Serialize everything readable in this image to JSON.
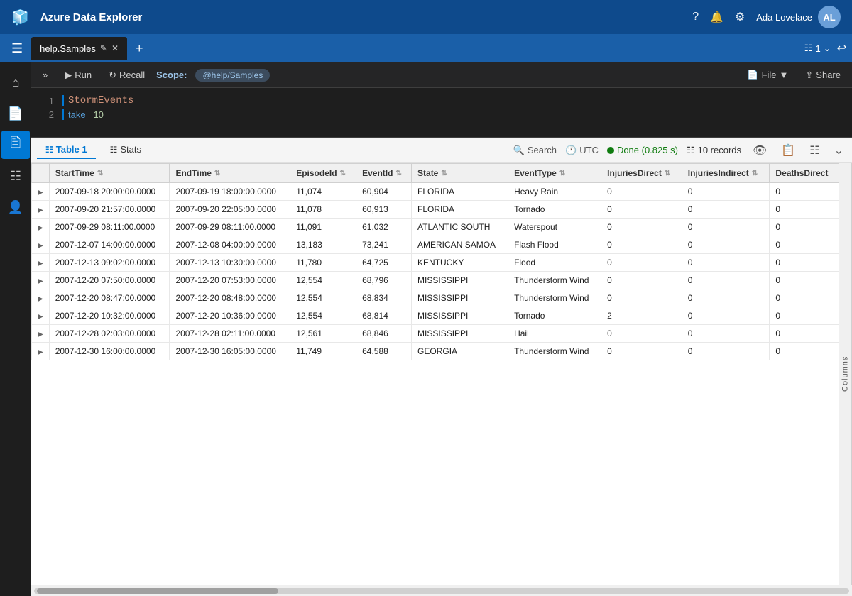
{
  "app": {
    "title": "Azure Data Explorer"
  },
  "topbar": {
    "help_icon": "?",
    "notification_icon": "🔔",
    "settings_icon": "⚙",
    "user_name": "Ada Lovelace"
  },
  "tabbar": {
    "tab_name": "help.Samples",
    "tab_counter": "1",
    "undo_icon": "↩"
  },
  "toolbar": {
    "run_label": "Run",
    "recall_label": "Recall",
    "scope_label": "Scope:",
    "scope_value": "@help/Samples",
    "file_label": "File",
    "share_label": "Share"
  },
  "query": {
    "line1": "StormEvents",
    "line2_kw": "take",
    "line2_num": "10"
  },
  "results": {
    "table_tab": "Table 1",
    "stats_tab": "Stats",
    "search_placeholder": "Search",
    "utc_label": "UTC",
    "status_label": "Done (0.825 s)",
    "records_label": "10 records",
    "columns_label": "Columns"
  },
  "columns": {
    "headers": [
      "",
      "StartTime",
      "EndTime",
      "EpisodeId",
      "EventId",
      "State",
      "EventType",
      "InjuriesDirect",
      "InjuriesIndirect",
      "DeathsDirect"
    ]
  },
  "rows": [
    {
      "expand": ">",
      "StartTime": "2007-09-18 20:00:00.0000",
      "EndTime": "2007-09-19 18:00:00.0000",
      "EpisodeId": "11,074",
      "EventId": "60,904",
      "State": "FLORIDA",
      "EventType": "Heavy Rain",
      "InjuriesDirect": "0",
      "InjuriesIndirect": "0",
      "DeathsDirect": "0"
    },
    {
      "expand": ">",
      "StartTime": "2007-09-20 21:57:00.0000",
      "EndTime": "2007-09-20 22:05:00.0000",
      "EpisodeId": "11,078",
      "EventId": "60,913",
      "State": "FLORIDA",
      "EventType": "Tornado",
      "InjuriesDirect": "0",
      "InjuriesIndirect": "0",
      "DeathsDirect": "0"
    },
    {
      "expand": ">",
      "StartTime": "2007-09-29 08:11:00.0000",
      "EndTime": "2007-09-29 08:11:00.0000",
      "EpisodeId": "11,091",
      "EventId": "61,032",
      "State": "ATLANTIC SOUTH",
      "EventType": "Waterspout",
      "InjuriesDirect": "0",
      "InjuriesIndirect": "0",
      "DeathsDirect": "0"
    },
    {
      "expand": ">",
      "StartTime": "2007-12-07 14:00:00.0000",
      "EndTime": "2007-12-08 04:00:00.0000",
      "EpisodeId": "13,183",
      "EventId": "73,241",
      "State": "AMERICAN SAMOA",
      "EventType": "Flash Flood",
      "InjuriesDirect": "0",
      "InjuriesIndirect": "0",
      "DeathsDirect": "0"
    },
    {
      "expand": ">",
      "StartTime": "2007-12-13 09:02:00.0000",
      "EndTime": "2007-12-13 10:30:00.0000",
      "EpisodeId": "11,780",
      "EventId": "64,725",
      "State": "KENTUCKY",
      "EventType": "Flood",
      "InjuriesDirect": "0",
      "InjuriesIndirect": "0",
      "DeathsDirect": "0"
    },
    {
      "expand": ">",
      "StartTime": "2007-12-20 07:50:00.0000",
      "EndTime": "2007-12-20 07:53:00.0000",
      "EpisodeId": "12,554",
      "EventId": "68,796",
      "State": "MISSISSIPPI",
      "EventType": "Thunderstorm Wind",
      "InjuriesDirect": "0",
      "InjuriesIndirect": "0",
      "DeathsDirect": "0"
    },
    {
      "expand": ">",
      "StartTime": "2007-12-20 08:47:00.0000",
      "EndTime": "2007-12-20 08:48:00.0000",
      "EpisodeId": "12,554",
      "EventId": "68,834",
      "State": "MISSISSIPPI",
      "EventType": "Thunderstorm Wind",
      "InjuriesDirect": "0",
      "InjuriesIndirect": "0",
      "DeathsDirect": "0"
    },
    {
      "expand": ">",
      "StartTime": "2007-12-20 10:32:00.0000",
      "EndTime": "2007-12-20 10:36:00.0000",
      "EpisodeId": "12,554",
      "EventId": "68,814",
      "State": "MISSISSIPPI",
      "EventType": "Tornado",
      "InjuriesDirect": "2",
      "InjuriesIndirect": "0",
      "DeathsDirect": "0"
    },
    {
      "expand": ">",
      "StartTime": "2007-12-28 02:03:00.0000",
      "EndTime": "2007-12-28 02:11:00.0000",
      "EpisodeId": "12,561",
      "EventId": "68,846",
      "State": "MISSISSIPPI",
      "EventType": "Hail",
      "InjuriesDirect": "0",
      "InjuriesIndirect": "0",
      "DeathsDirect": "0"
    },
    {
      "expand": ">",
      "StartTime": "2007-12-30 16:00:00.0000",
      "EndTime": "2007-12-30 16:05:00.0000",
      "EpisodeId": "11,749",
      "EventId": "64,588",
      "State": "GEORGIA",
      "EventType": "Thunderstorm Wind",
      "InjuriesDirect": "0",
      "InjuriesIndirect": "0",
      "DeathsDirect": "0"
    }
  ]
}
